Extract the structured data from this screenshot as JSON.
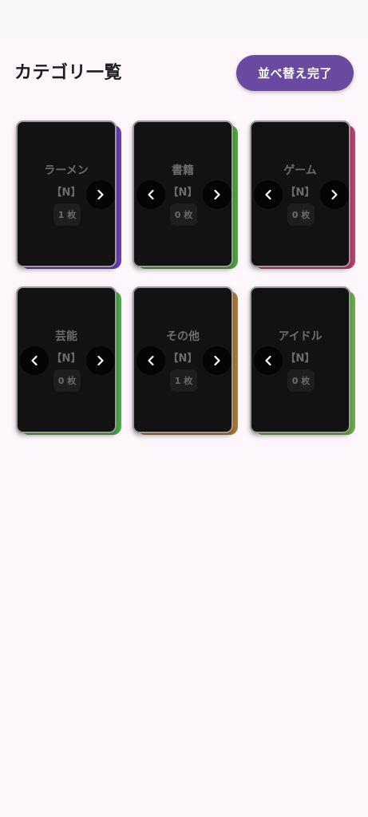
{
  "header": {
    "title": "カテゴリ一覧",
    "done_label": "並べ替え完了"
  },
  "colors": {
    "primary": "#6a4aa1",
    "card_bg": "#121212",
    "background": "#fdf7fc"
  },
  "cards": [
    {
      "name": "ラーメン",
      "tag": "【N】",
      "count": "1 枚",
      "accent": "#6a3fb8",
      "has_prev": false,
      "has_next": true
    },
    {
      "name": "書籍",
      "tag": "【N】",
      "count": "0 枚",
      "accent": "#4caa3c",
      "has_prev": true,
      "has_next": true
    },
    {
      "name": "ゲーム",
      "tag": "【N】",
      "count": "0 枚",
      "accent": "#c2406e",
      "has_prev": true,
      "has_next": true
    },
    {
      "name": "芸能",
      "tag": "【N】",
      "count": "0 枚",
      "accent": "#49b048",
      "has_prev": true,
      "has_next": true
    },
    {
      "name": "その他",
      "tag": "【N】",
      "count": "1 枚",
      "accent": "#b07a35",
      "has_prev": true,
      "has_next": true
    },
    {
      "name": "アイドル",
      "tag": "【N】",
      "count": "0 枚",
      "accent": "#6cb24a",
      "has_prev": true,
      "has_next": false
    }
  ],
  "icons": {
    "prev": "chevron-left-icon",
    "next": "chevron-right-icon"
  }
}
